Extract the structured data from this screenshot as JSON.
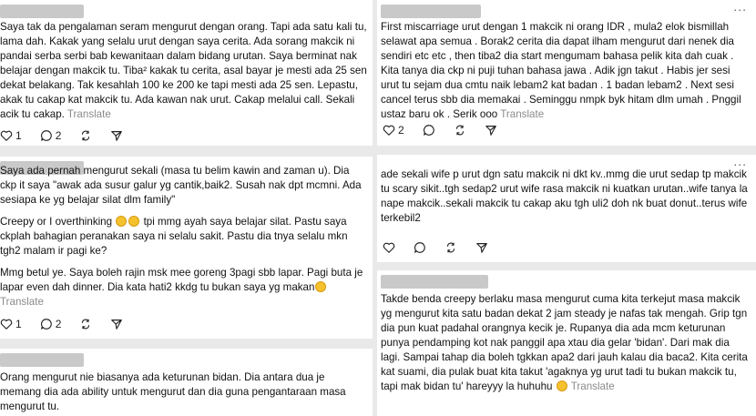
{
  "left_column": {
    "comments": [
      {
        "paragraphs": [
          "Saya tak da pengalaman seram mengurut dengan orang. Tapi ada satu kali tu, lama dah. Kakak yang selalu urut dengan saya cerita. Ada sorang makcik ni pandai serba serbi bab kewanitaan dalam bidang urutan. Saya berminat nak belajar dengan makcik tu. Tiba² kakak tu cerita, asal bayar je mesti ada 25 sen dekat belakang. Tak kesahlah 100 ke 200 ke tapi mesti ada 25 sen. Lepastu, akak tu cakap kat makcik tu. Ada kawan nak urut. Cakap melalui call. Sekali acik tu cakap."
        ],
        "translate": "Translate",
        "likes": "1",
        "replies": "2"
      },
      {
        "paragraphs": [
          "Saya ada pernah mengurut sekali (masa tu belim kawin and zaman u). Dia ckp it saya \"awak ada susur galur yg cantik,baik2. Susah nak dpt mcmni. Ada sesiapa ke yg belajar silat dlm family\"",
          "Creepy or I overthinking",
          "tpi mmg ayah saya belajar silat. Pastu saya ckplah bahagian peranakan saya ni selalu sakit. Pastu dia tnya selalu mkn tgh2 malam ir pagi ke?",
          "Mmg betul ye. Saya boleh rajin msk mee goreng 3pagi sbb lapar. Pagi buta je lapar even dah dinner. Dia kata hati2 kkdg tu bukan saya yg makan"
        ],
        "translate": "Translate",
        "likes": "1",
        "replies": "2"
      },
      {
        "paragraphs": [
          "Orang mengurut nie biasanya ada keturunan bidan. Dia antara dua je memang dia ada ability untuk mengurut dan dia guna pengantaraan masa mengurut tu."
        ]
      }
    ]
  },
  "right_column": {
    "comments": [
      {
        "paragraphs": [
          "First miscarriage urut dengan 1 makcik ni orang IDR , mula2 elok bismillah selawat apa semua . Borak2 cerita dia dapat ilham mengurut dari nenek dia sendiri etc etc , then tiba2 dia start mengumam bahasa pelik kita dah cuak . Kita tanya dia ckp ni puji tuhan bahasa jawa . Adik jgn takut . Habis jer sesi urut tu sejam dua cmtu naik lebam2 kat badan . 1 badan lebam2 . Next sesi cancel terus sbb dia memakai . Seminggu nmpk byk hitam dlm umah . Pnggil ustaz baru ok . Serik ooo"
        ],
        "translate": "Translate",
        "likes": "2",
        "replies": ""
      },
      {
        "paragraphs": [
          "ade sekali wife p urut dgn satu makcik ni dkt kv..mmg die urut sedap tp makcik tu scary sikit..tgh sedap2 urut wife rasa makcik ni kuatkan urutan..wife tanya la nape makcik..sekali makcik tu cakap aku tgh uli2 doh nk buat donut..terus wife terkebil2"
        ],
        "translate": "",
        "likes": "",
        "replies": ""
      },
      {
        "paragraphs": [
          "Takde benda creepy berlaku masa mengurut cuma kita terkejut masa makcik yg mengurut kita satu badan dekat 2 jam steady je nafas tak mengah. Grip tgn dia pun kuat padahal orangnya kecik je. Rupanya dia ada mcm keturunan punya pendamping kot nak panggil apa xtau dia gelar 'bidan'. Dari mak dia lagi. Sampai tahap dia boleh tgkkan apa2 dari jauh kalau dia baca2. Kita cerita kat suami, dia pulak buat kita takut 'agaknya yg urut tadi tu bukan makcik tu, tapi mak bidan tu' hareyyy la huhuhu"
        ],
        "translate": "Translate"
      }
    ]
  },
  "icons": {
    "like": "heart-icon",
    "reply": "comment-bubble-icon",
    "repost": "repost-icon",
    "share": "send-icon",
    "more": "more-dots-icon"
  },
  "more_label": "...",
  "colors": {
    "background": "#e9e9e9",
    "card": "#ffffff",
    "name_placeholder": "#c9c9c9",
    "muted": "#8a8a8a"
  }
}
